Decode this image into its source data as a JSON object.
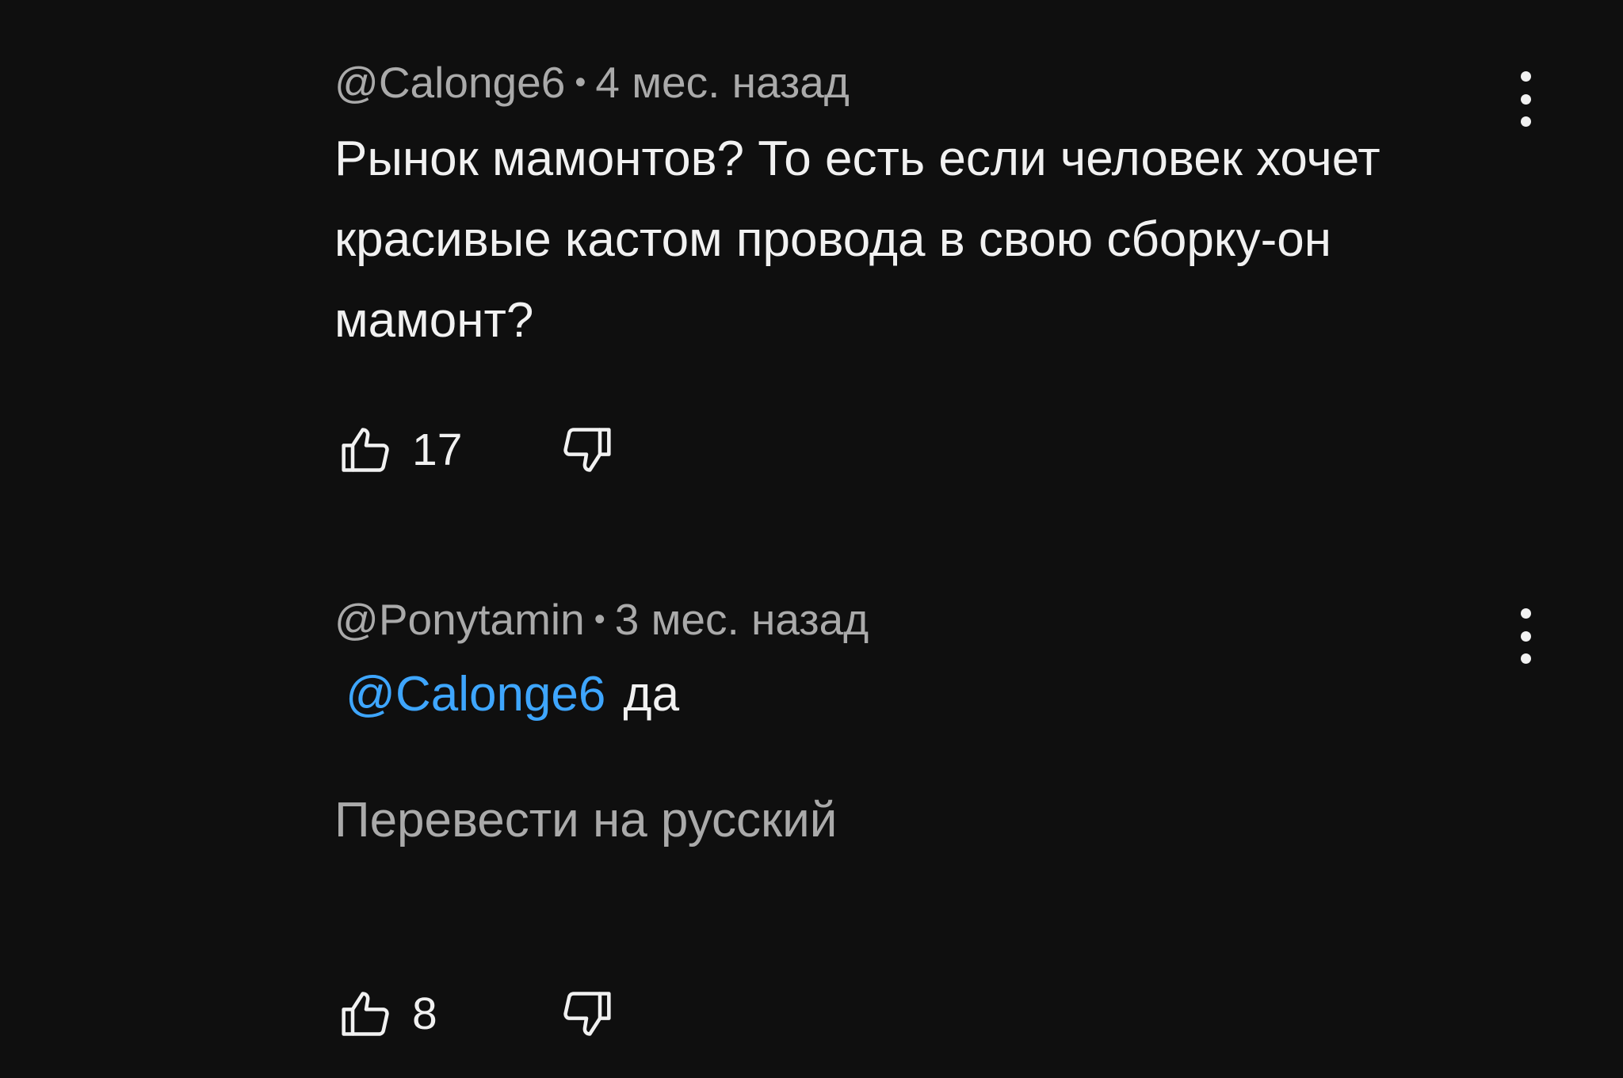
{
  "comments": [
    {
      "author": "@Calonge6",
      "time": "4 мес. назад",
      "text": "Рынок мамонтов? То есть если человек хочет красивые кастом провода в свою сборку-он мамонт?",
      "likes": "17"
    },
    {
      "author": "@Ponytamin",
      "time": "3 мес. назад",
      "mention": "@Calonge6",
      "text": "да",
      "translate_label": "Перевести на русский",
      "likes": "8"
    }
  ],
  "separator": "•",
  "icons": {
    "like": "thumbs-up-icon",
    "dislike": "thumbs-down-icon",
    "more": "more-vertical-icon"
  },
  "colors": {
    "background": "#0f0f0f",
    "text": "#f1f1f1",
    "secondary": "#aaaaaa",
    "mention": "#3ea6ff"
  }
}
